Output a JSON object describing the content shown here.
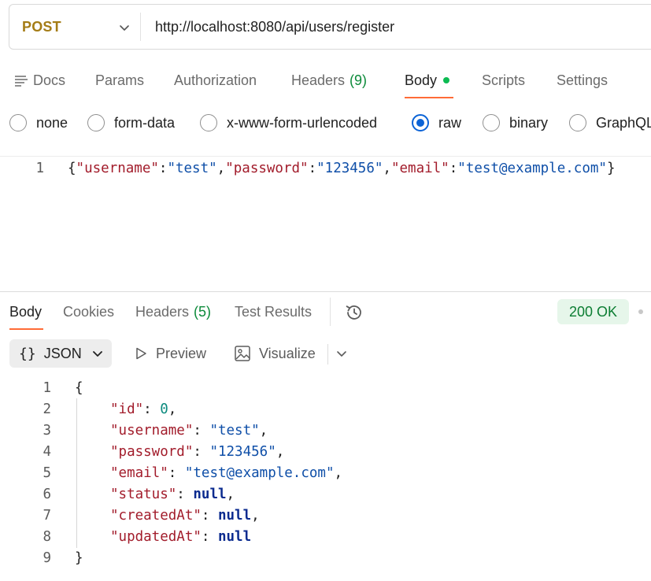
{
  "request": {
    "method": "POST",
    "url": "http://localhost:8080/api/users/register"
  },
  "request_tabs": {
    "docs": "Docs",
    "params": "Params",
    "authorization": "Authorization",
    "headers": "Headers",
    "headers_count": "(9)",
    "body": "Body",
    "scripts": "Scripts",
    "settings": "Settings"
  },
  "body_types": {
    "none": "none",
    "form_data": "form-data",
    "urlencoded": "x-www-form-urlencoded",
    "raw": "raw",
    "binary": "binary",
    "graphql": "GraphQL",
    "selected": "raw"
  },
  "editor": {
    "line_number": "1",
    "tokens": [
      "{",
      "\"username\"",
      ":",
      "\"test\"",
      ",",
      "\"password\"",
      ":",
      "\"123456\"",
      ",",
      "\"email\"",
      ":",
      "\"test@example.com\"",
      "}"
    ]
  },
  "response_tabs": {
    "body": "Body",
    "cookies": "Cookies",
    "headers": "Headers",
    "headers_count": "(5)",
    "test_results": "Test Results",
    "status": "200 OK"
  },
  "response_toolbar": {
    "format": "JSON",
    "preview": "Preview",
    "visualize": "Visualize"
  },
  "response_body": {
    "line_numbers": [
      "1",
      "2",
      "3",
      "4",
      "5",
      "6",
      "7",
      "8",
      "9"
    ],
    "open_brace": "{",
    "close_brace": "}",
    "rows": [
      {
        "key": "\"id\"",
        "value": "0",
        "type": "num",
        "comma": ","
      },
      {
        "key": "\"username\"",
        "value": "\"test\"",
        "type": "str",
        "comma": ","
      },
      {
        "key": "\"password\"",
        "value": "\"123456\"",
        "type": "str",
        "comma": ","
      },
      {
        "key": "\"email\"",
        "value": "\"test@example.com\"",
        "type": "str",
        "comma": ","
      },
      {
        "key": "\"status\"",
        "value": "null",
        "type": "null",
        "comma": ","
      },
      {
        "key": "\"createdAt\"",
        "value": "null",
        "type": "null",
        "comma": ","
      },
      {
        "key": "\"updatedAt\"",
        "value": "null",
        "type": "null",
        "comma": ""
      }
    ]
  },
  "colors": {
    "accent": "#ff6c37",
    "method": "#a47c16",
    "radio_selected": "#0b63d6",
    "status_bg": "#e6f6ea",
    "status_text": "#0b7d32",
    "json_key": "#a21c2b",
    "json_string": "#0f4fa8",
    "json_null": "#0b2b8f",
    "json_number": "#0b8a7e"
  },
  "icons": {
    "docs": "docs-icon",
    "method_dropdown": "chevron-down-icon",
    "history": "history-icon",
    "format_dropdown": "chevron-down-icon",
    "preview": "play-icon",
    "visualize": "image-icon",
    "more_dropdown": "chevron-down-icon"
  }
}
